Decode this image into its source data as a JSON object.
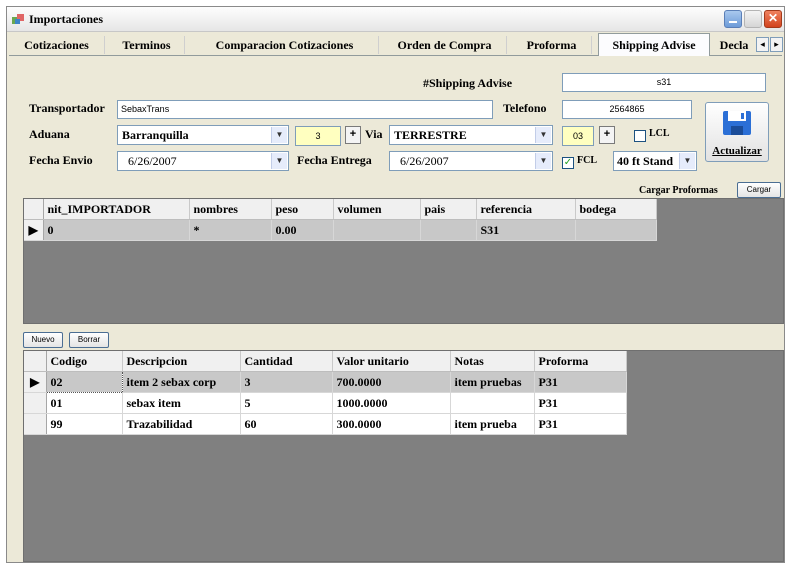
{
  "window": {
    "title": "Importaciones",
    "close_glyph": "✕"
  },
  "tabs": [
    {
      "label": "Cotizaciones"
    },
    {
      "label": "Terminos"
    },
    {
      "label": "Comparacion Cotizaciones"
    },
    {
      "label": "Orden de Compra"
    },
    {
      "label": "Proforma"
    },
    {
      "label": "Shipping Advise",
      "active": true
    },
    {
      "label": "Decla"
    }
  ],
  "tab_scroll": {
    "left": "◂",
    "right": "▸"
  },
  "header": {
    "shipping_label": "#Shipping Advise",
    "shipping_value": "s31"
  },
  "form": {
    "transportador_label": "Transportador",
    "transportador_value": "SebaxTrans",
    "telefono_label": "Telefono",
    "telefono_value": "2564865",
    "aduana_label": "Aduana",
    "aduana_value": "Barranquilla",
    "aduana_code": "3",
    "via_label": "Via",
    "via_value": "TERRESTRE",
    "via_code": "03",
    "lcl_label": "LCL",
    "lcl_checked": false,
    "fcl_label": "FCL",
    "fcl_checked": true,
    "fecha_envio_label": "Fecha Envio",
    "fecha_envio_value": "6/26/2007",
    "fecha_entrega_label": "Fecha Entrega",
    "fecha_entrega_value": "6/26/2007",
    "container_value": "40 ft Stand",
    "plus_glyph": "+",
    "check_glyph": "✓",
    "arrow_glyph": "▼",
    "row_pointer_glyph": "▶"
  },
  "actions": {
    "actualizar_label": "Actualizar",
    "cargar_proformas_label": "Cargar Proformas",
    "cargar_button": "Cargar",
    "nuevo_button": "Nuevo",
    "borrar_button": "Borrar"
  },
  "grid_top": {
    "columns": [
      "nit_IMPORTADOR",
      "nombres",
      "peso",
      "volumen",
      "pais",
      "referencia",
      "bodega"
    ],
    "rows": [
      [
        "0",
        "*",
        "0.00",
        "",
        "",
        "S31",
        ""
      ]
    ]
  },
  "grid_bottom": {
    "columns": [
      "Codigo",
      "Descripcion",
      "Cantidad",
      "Valor unitario",
      "Notas",
      "Proforma"
    ],
    "rows": [
      [
        "02",
        "item 2 sebax corp",
        "3",
        "700.0000",
        "item pruebas",
        "P31"
      ],
      [
        "01",
        "sebax item",
        "5",
        "1000.0000",
        "",
        "P31"
      ],
      [
        "99",
        "Trazabilidad",
        "60",
        "300.0000",
        "item prueba",
        "P31"
      ]
    ]
  },
  "colors": {
    "window_bg": "#ECE9D8",
    "grid_bg": "#808080",
    "input_border": "#7f9db9",
    "yellow_field": "#ffffc0"
  }
}
